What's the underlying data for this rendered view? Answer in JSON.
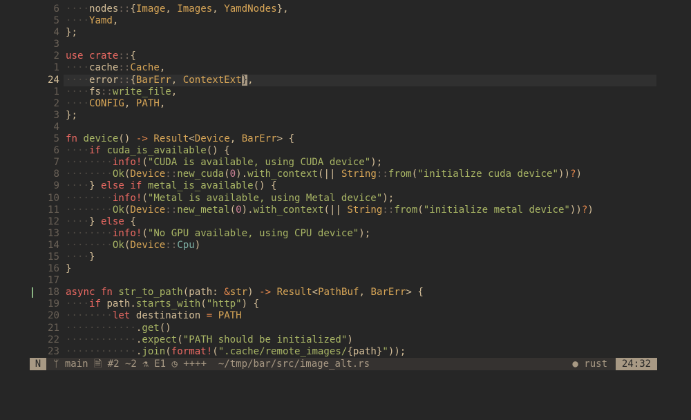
{
  "editor": {
    "lines": [
      {
        "num": "6",
        "current": false,
        "tokens": [
          [
            "ind",
            "····"
          ],
          [
            "plain",
            "nodes"
          ],
          [
            "sep",
            "::"
          ],
          [
            "punc",
            "{"
          ],
          [
            "type",
            "Image"
          ],
          [
            "punc",
            ", "
          ],
          [
            "type",
            "Images"
          ],
          [
            "punc",
            ", "
          ],
          [
            "type",
            "YamdNodes"
          ],
          [
            "punc",
            "},"
          ]
        ]
      },
      {
        "num": "5",
        "current": false,
        "tokens": [
          [
            "ind",
            "····"
          ],
          [
            "type",
            "Yamd"
          ],
          [
            "punc",
            ","
          ]
        ]
      },
      {
        "num": "4",
        "current": false,
        "tokens": [
          [
            "punc",
            "};"
          ]
        ]
      },
      {
        "num": "3",
        "current": false,
        "tokens": []
      },
      {
        "num": "2",
        "current": false,
        "tokens": [
          [
            "kw",
            "use"
          ],
          [
            "punc",
            " "
          ],
          [
            "kw",
            "crate"
          ],
          [
            "sep",
            "::"
          ],
          [
            "punc",
            "{"
          ]
        ]
      },
      {
        "num": "1",
        "current": false,
        "tokens": [
          [
            "ind",
            "····"
          ],
          [
            "plain",
            "cache"
          ],
          [
            "sep",
            "::"
          ],
          [
            "type",
            "Cache"
          ],
          [
            "punc",
            ","
          ]
        ]
      },
      {
        "num": "24",
        "current": true,
        "tokens": [
          [
            "ind",
            "····"
          ],
          [
            "plain",
            "error"
          ],
          [
            "sep",
            "::"
          ],
          [
            "punc",
            "{"
          ],
          [
            "type",
            "BarErr"
          ],
          [
            "punc",
            ", "
          ],
          [
            "type",
            "ContextExt"
          ],
          [
            "cursor",
            "}"
          ],
          [
            "punc",
            ","
          ]
        ]
      },
      {
        "num": "1",
        "current": false,
        "tokens": [
          [
            "ind",
            "····"
          ],
          [
            "plain",
            "fs"
          ],
          [
            "sep",
            "::"
          ],
          [
            "fn",
            "write_file"
          ],
          [
            "punc",
            ","
          ]
        ]
      },
      {
        "num": "2",
        "current": false,
        "tokens": [
          [
            "ind",
            "····"
          ],
          [
            "type",
            "CONFIG"
          ],
          [
            "punc",
            ", "
          ],
          [
            "type",
            "PATH"
          ],
          [
            "punc",
            ","
          ]
        ]
      },
      {
        "num": "3",
        "current": false,
        "tokens": [
          [
            "punc",
            "};"
          ]
        ]
      },
      {
        "num": "4",
        "current": false,
        "tokens": []
      },
      {
        "num": "5",
        "current": false,
        "tokens": [
          [
            "kw",
            "fn"
          ],
          [
            "punc",
            " "
          ],
          [
            "fn",
            "device"
          ],
          [
            "punc",
            "() "
          ],
          [
            "op",
            "->"
          ],
          [
            "punc",
            " "
          ],
          [
            "type",
            "Result"
          ],
          [
            "punc",
            "<"
          ],
          [
            "type",
            "Device"
          ],
          [
            "punc",
            ", "
          ],
          [
            "type",
            "BarErr"
          ],
          [
            "punc",
            "> {"
          ]
        ]
      },
      {
        "num": "6",
        "current": false,
        "tokens": [
          [
            "ind",
            "····"
          ],
          [
            "kw",
            "if"
          ],
          [
            "punc",
            " "
          ],
          [
            "fn",
            "cuda_is_available"
          ],
          [
            "punc",
            "() {"
          ]
        ]
      },
      {
        "num": "7",
        "current": false,
        "tokens": [
          [
            "ind",
            "········"
          ],
          [
            "mac",
            "info!"
          ],
          [
            "punc",
            "("
          ],
          [
            "str",
            "\"CUDA is available, using CUDA device\""
          ],
          [
            "punc",
            ");"
          ]
        ]
      },
      {
        "num": "8",
        "current": false,
        "tokens": [
          [
            "ind",
            "········"
          ],
          [
            "fn",
            "Ok"
          ],
          [
            "punc",
            "("
          ],
          [
            "type",
            "Device"
          ],
          [
            "sep",
            "::"
          ],
          [
            "fn",
            "new_cuda"
          ],
          [
            "punc",
            "("
          ],
          [
            "num",
            "0"
          ],
          [
            "punc",
            ")."
          ],
          [
            "fn",
            "with_context"
          ],
          [
            "punc",
            "(|| "
          ],
          [
            "type",
            "String"
          ],
          [
            "sep",
            "::"
          ],
          [
            "fn",
            "from"
          ],
          [
            "punc",
            "("
          ],
          [
            "str",
            "\"initialize cuda device\""
          ],
          [
            "punc",
            "))"
          ],
          [
            "op",
            "?"
          ],
          [
            "punc",
            ")"
          ]
        ]
      },
      {
        "num": "9",
        "current": false,
        "tokens": [
          [
            "ind",
            "····"
          ],
          [
            "punc",
            "} "
          ],
          [
            "kw",
            "else if"
          ],
          [
            "punc",
            " "
          ],
          [
            "fn",
            "metal_is_available"
          ],
          [
            "punc",
            "() {"
          ]
        ]
      },
      {
        "num": "10",
        "current": false,
        "tokens": [
          [
            "ind",
            "········"
          ],
          [
            "mac",
            "info!"
          ],
          [
            "punc",
            "("
          ],
          [
            "str",
            "\"Metal is available, using Metal device\""
          ],
          [
            "punc",
            ");"
          ]
        ]
      },
      {
        "num": "11",
        "current": false,
        "tokens": [
          [
            "ind",
            "········"
          ],
          [
            "fn",
            "Ok"
          ],
          [
            "punc",
            "("
          ],
          [
            "type",
            "Device"
          ],
          [
            "sep",
            "::"
          ],
          [
            "fn",
            "new_metal"
          ],
          [
            "punc",
            "("
          ],
          [
            "num",
            "0"
          ],
          [
            "punc",
            ")."
          ],
          [
            "fn",
            "with_context"
          ],
          [
            "punc",
            "(|| "
          ],
          [
            "type",
            "String"
          ],
          [
            "sep",
            "::"
          ],
          [
            "fn",
            "from"
          ],
          [
            "punc",
            "("
          ],
          [
            "str",
            "\"initialize metal device\""
          ],
          [
            "punc",
            "))"
          ],
          [
            "op",
            "?"
          ],
          [
            "punc",
            ")"
          ]
        ]
      },
      {
        "num": "12",
        "current": false,
        "tokens": [
          [
            "ind",
            "····"
          ],
          [
            "punc",
            "} "
          ],
          [
            "kw",
            "else"
          ],
          [
            "punc",
            " {"
          ]
        ]
      },
      {
        "num": "13",
        "current": false,
        "tokens": [
          [
            "ind",
            "········"
          ],
          [
            "mac",
            "info!"
          ],
          [
            "punc",
            "("
          ],
          [
            "str",
            "\"No GPU available, using CPU device\""
          ],
          [
            "punc",
            ");"
          ]
        ]
      },
      {
        "num": "14",
        "current": false,
        "tokens": [
          [
            "ind",
            "········"
          ],
          [
            "fn",
            "Ok"
          ],
          [
            "punc",
            "("
          ],
          [
            "type",
            "Device"
          ],
          [
            "sep",
            "::"
          ],
          [
            "ns",
            "Cpu"
          ],
          [
            "punc",
            ")"
          ]
        ]
      },
      {
        "num": "15",
        "current": false,
        "tokens": [
          [
            "ind",
            "····"
          ],
          [
            "punc",
            "}"
          ]
        ]
      },
      {
        "num": "16",
        "current": false,
        "tokens": [
          [
            "punc",
            "}"
          ]
        ]
      },
      {
        "num": "17",
        "current": false,
        "tokens": []
      },
      {
        "num": "18",
        "current": false,
        "mark": true,
        "tokens": [
          [
            "kw",
            "async"
          ],
          [
            "punc",
            " "
          ],
          [
            "kw",
            "fn"
          ],
          [
            "punc",
            " "
          ],
          [
            "fn",
            "str_to_path"
          ],
          [
            "punc",
            "("
          ],
          [
            "plain",
            "path"
          ],
          [
            "punc",
            ": "
          ],
          [
            "op",
            "&"
          ],
          [
            "type",
            "str"
          ],
          [
            "punc",
            ") "
          ],
          [
            "op",
            "->"
          ],
          [
            "punc",
            " "
          ],
          [
            "type",
            "Result"
          ],
          [
            "punc",
            "<"
          ],
          [
            "type",
            "PathBuf"
          ],
          [
            "punc",
            ", "
          ],
          [
            "type",
            "BarErr"
          ],
          [
            "punc",
            "> {"
          ]
        ]
      },
      {
        "num": "19",
        "current": false,
        "tokens": [
          [
            "ind",
            "····"
          ],
          [
            "kw",
            "if"
          ],
          [
            "punc",
            " "
          ],
          [
            "plain",
            "path"
          ],
          [
            "punc",
            "."
          ],
          [
            "fn",
            "starts_with"
          ],
          [
            "punc",
            "("
          ],
          [
            "str",
            "\"http\""
          ],
          [
            "punc",
            ") {"
          ]
        ]
      },
      {
        "num": "20",
        "current": false,
        "tokens": [
          [
            "ind",
            "········"
          ],
          [
            "kw",
            "let"
          ],
          [
            "punc",
            " "
          ],
          [
            "plain",
            "destination"
          ],
          [
            "punc",
            " "
          ],
          [
            "op",
            "="
          ],
          [
            "punc",
            " "
          ],
          [
            "type",
            "PATH"
          ]
        ]
      },
      {
        "num": "21",
        "current": false,
        "tokens": [
          [
            "ind",
            "············"
          ],
          [
            "punc",
            "."
          ],
          [
            "fn",
            "get"
          ],
          [
            "punc",
            "()"
          ]
        ]
      },
      {
        "num": "22",
        "current": false,
        "tokens": [
          [
            "ind",
            "············"
          ],
          [
            "punc",
            "."
          ],
          [
            "fn",
            "expect"
          ],
          [
            "punc",
            "("
          ],
          [
            "str",
            "\"PATH should be initialized\""
          ],
          [
            "punc",
            ")"
          ]
        ]
      },
      {
        "num": "23",
        "current": false,
        "tokens": [
          [
            "ind",
            "············"
          ],
          [
            "punc",
            "."
          ],
          [
            "fn",
            "join"
          ],
          [
            "punc",
            "("
          ],
          [
            "mac",
            "format!"
          ],
          [
            "punc",
            "("
          ],
          [
            "str",
            "\".cache/remote_images/"
          ],
          [
            "punc",
            "{"
          ],
          [
            "plain",
            "path"
          ],
          [
            "punc",
            "}"
          ],
          [
            "str",
            "\""
          ],
          [
            "punc",
            "));"
          ]
        ]
      }
    ]
  },
  "status": {
    "mode": "N",
    "branch_icon": "git-branch-icon",
    "branch": "main",
    "buffer_icon": "file-icon",
    "buffer": "#2",
    "diff": "~2",
    "error_icon": "flask-icon",
    "errors": "E1",
    "lsp_icon": "gauge-icon",
    "changes": "++++",
    "path": "~/tmp/bar/src/image_alt.rs",
    "filetype_icon": "circle-icon",
    "filetype": "rust",
    "position": "24:32"
  }
}
